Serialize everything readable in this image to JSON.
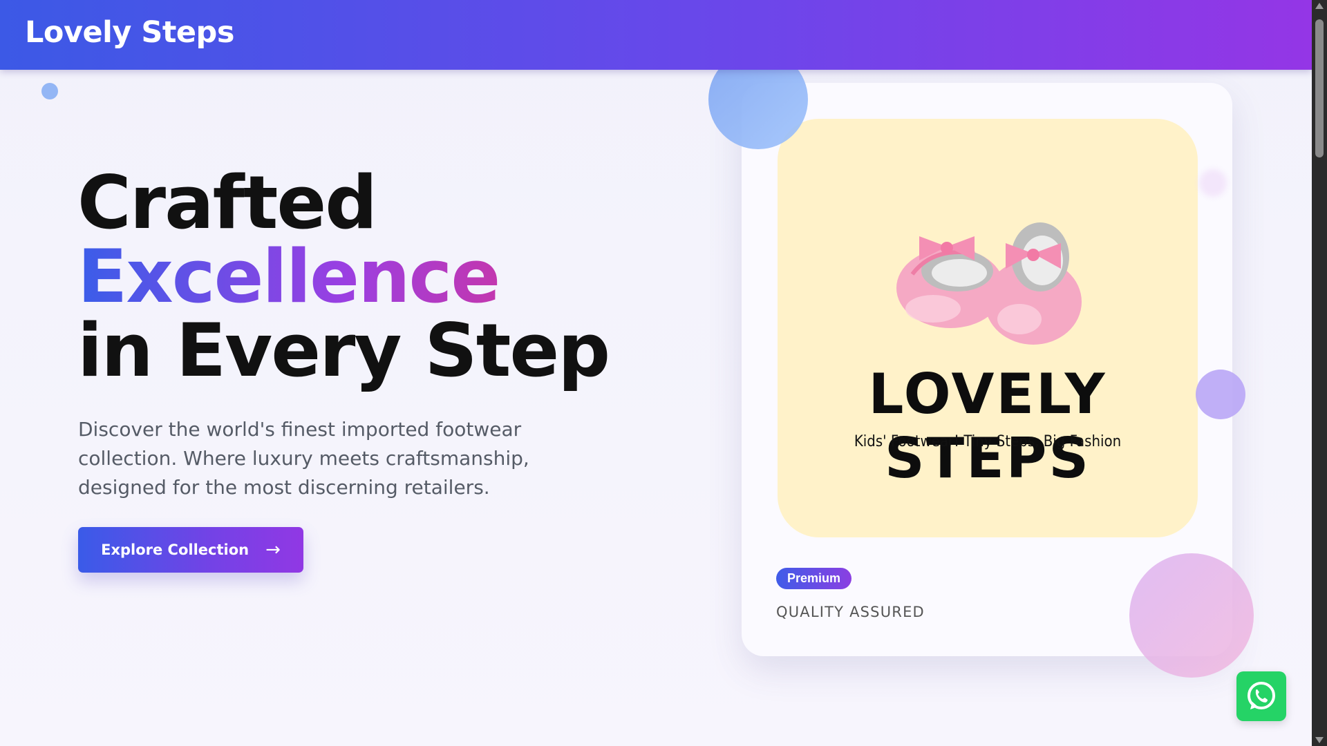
{
  "header": {
    "brand": "Lovely Steps"
  },
  "hero": {
    "title_line1": "Crafted",
    "title_line2": "Excellence",
    "title_line3": "in Every Step",
    "description": "Discover the world's finest imported footwear collection. Where luxury meets craftsmanship, designed for the most discerning retailers.",
    "cta_label": "Explore Collection"
  },
  "card": {
    "logo_title": "LOVELY STEPS",
    "logo_tagline": "Kids' Footwear! Tiny Steps, Big Fashion",
    "badge": "Premium",
    "quality": "QUALITY ASSURED"
  },
  "icons": {
    "cta_arrow": "arrow-right-icon",
    "whatsapp": "whatsapp-icon",
    "shoes": "baby-shoes-icon"
  },
  "colors": {
    "header_start": "#3c59e6",
    "header_end": "#9436e6",
    "logo_panel": "#fff2c9",
    "whatsapp": "#25d366"
  }
}
